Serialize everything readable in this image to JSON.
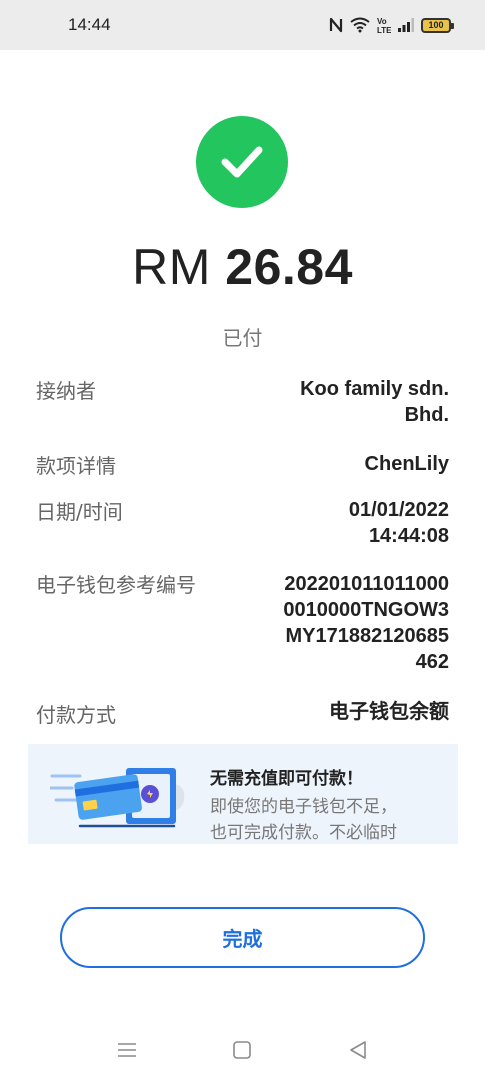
{
  "status_bar": {
    "time": "14:44",
    "battery": "100",
    "icons": [
      "nfc-icon",
      "wifi-icon",
      "volte-icon",
      "signal-icon",
      "battery-icon"
    ]
  },
  "payment": {
    "currency": "RM",
    "amount": "26.84",
    "status": "已付",
    "accent_color": "#22c55e"
  },
  "details": {
    "recipient": {
      "label": "接纳者",
      "value_lines": [
        "Koo family sdn.",
        "Bhd."
      ]
    },
    "payment_detail": {
      "label": "款项详情",
      "value": "ChenLily"
    },
    "datetime": {
      "label": "日期/时间",
      "value_lines": [
        "01/01/2022",
        "14:44:08"
      ]
    },
    "reference": {
      "label": "电子钱包参考编号",
      "value_lines": [
        "202201011011000",
        "0010000TNGOW3",
        "MY171882120685",
        "462"
      ]
    },
    "method": {
      "label": "付款方式",
      "value": "电子钱包余额"
    }
  },
  "promo": {
    "title": "无需充值即可付款！",
    "desc_lines": [
      "即使您的电子钱包不足，",
      "也可完成付款。不必临时"
    ]
  },
  "done_button": {
    "label": "完成",
    "color": "#1f6fe0"
  },
  "nav": {
    "icons": [
      "menu-icon",
      "home-icon",
      "back-icon"
    ]
  }
}
